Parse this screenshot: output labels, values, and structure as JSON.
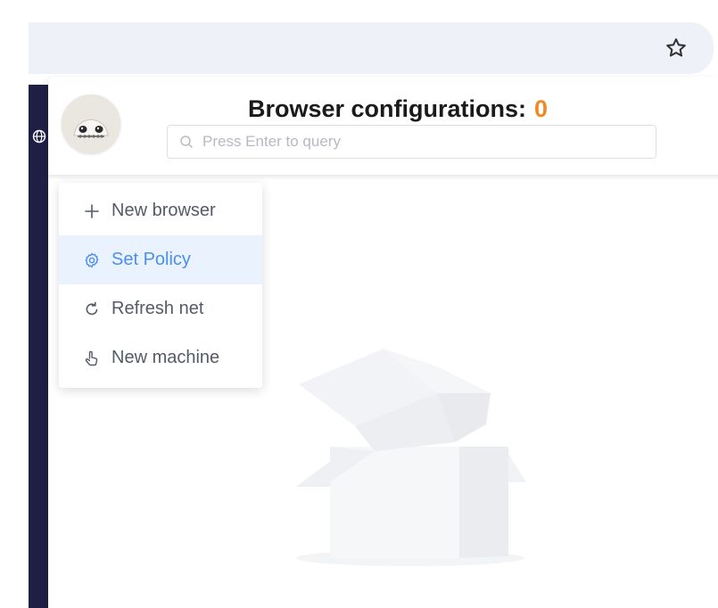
{
  "browser": {
    "star_icon": "star-outline-icon",
    "side_icon": "globe-icon"
  },
  "header": {
    "title": "Browser configurations:",
    "count": "0",
    "count_color": "#f08a24",
    "avatar_icon": "avatar-image"
  },
  "search": {
    "placeholder": "Press Enter to query",
    "value": "",
    "icon": "search-icon"
  },
  "menu": {
    "items": [
      {
        "label": "New browser",
        "icon": "plus-icon",
        "active": false
      },
      {
        "label": "Set Policy",
        "icon": "gear-icon",
        "active": true
      },
      {
        "label": "Refresh net",
        "icon": "refresh-icon",
        "active": false
      },
      {
        "label": "New machine",
        "icon": "hand-pointer-icon",
        "active": false
      }
    ],
    "active_color": "#4a8ff0"
  },
  "empty_state": {
    "icon": "empty-box-icon"
  }
}
